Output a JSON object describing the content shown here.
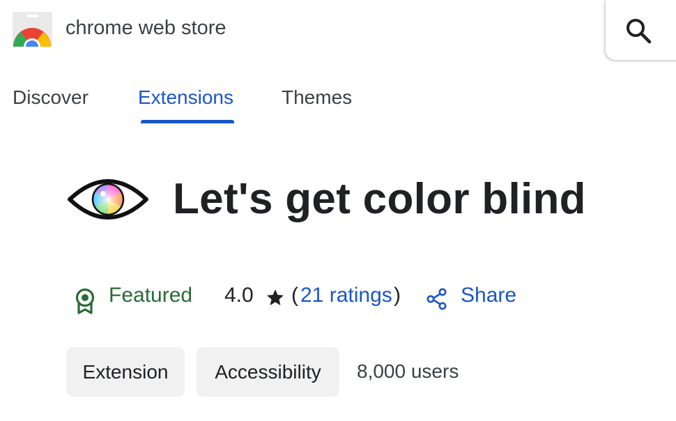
{
  "header": {
    "store_name": "chrome web store",
    "logo_icon": "chrome-web-store-logo",
    "search_icon": "search-icon"
  },
  "tabs": [
    {
      "label": "Discover",
      "active": false
    },
    {
      "label": "Extensions",
      "active": true
    },
    {
      "label": "Themes",
      "active": false
    }
  ],
  "extension": {
    "title": "Let's get color blind",
    "icon": "eye-icon",
    "featured_label": "Featured",
    "rating": "4.0",
    "ratings_text": "21 ratings",
    "share_label": "Share",
    "chips": [
      "Extension",
      "Accessibility"
    ],
    "users": "8,000 users"
  },
  "colors": {
    "accent": "#1a56c9",
    "featured": "#2a6a35",
    "text": "#202124",
    "chip_bg": "#f0f1f0"
  }
}
